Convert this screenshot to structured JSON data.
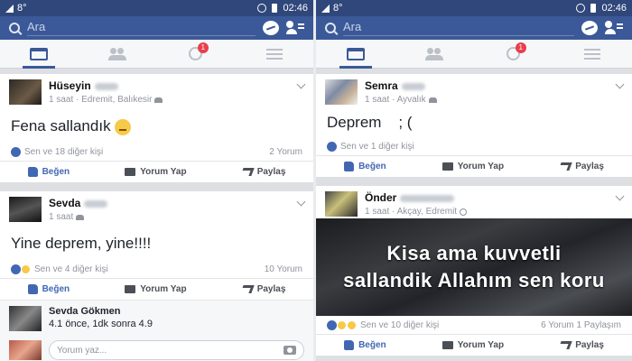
{
  "left": {
    "status": {
      "signal": "8°",
      "time": "02:46"
    },
    "search": {
      "placeholder": "Ara"
    },
    "tabs": {
      "notif_badge": "1"
    },
    "posts": [
      {
        "author": "Hüseyin",
        "meta": "1 saat · Edremit, Balıkesir",
        "text": "Fena sallandık",
        "reactions_text": "Sen ve 18 diğer kişi",
        "comments_text": "2 Yorum"
      },
      {
        "author": "Sevda",
        "meta": "1 saat",
        "text": "Yine deprem, yine!!!!",
        "reactions_text": "Sen ve 4 diğer kişi",
        "comments_text": "10 Yorum",
        "comment": {
          "author": "Sevda Gökmen",
          "text": "4.1 önce, 1dk sonra 4.9"
        },
        "write_placeholder": "Yorum yaz..."
      }
    ]
  },
  "right": {
    "status": {
      "signal": "8°",
      "time": "02:46"
    },
    "search": {
      "placeholder": "Ara"
    },
    "tabs": {
      "notif_badge": "1"
    },
    "posts": [
      {
        "author": "Semra",
        "meta": "1 saat · Ayvalık",
        "text": "Deprem    ; (",
        "reactions_text": "Sen ve 1 diğer kişi"
      },
      {
        "author": "Önder",
        "meta": "1 saat · Akçay, Edremit",
        "image_line1": "Kisa ama kuvvetli",
        "image_line2": "sallandik Allahım sen koru",
        "reactions_text": "Sen ve 10 diğer kişi",
        "comments_text": "6 Yorum 1 Paylaşım"
      }
    ]
  },
  "actions": {
    "like": "Beğen",
    "comment": "Yorum Yap",
    "share": "Paylaş"
  }
}
